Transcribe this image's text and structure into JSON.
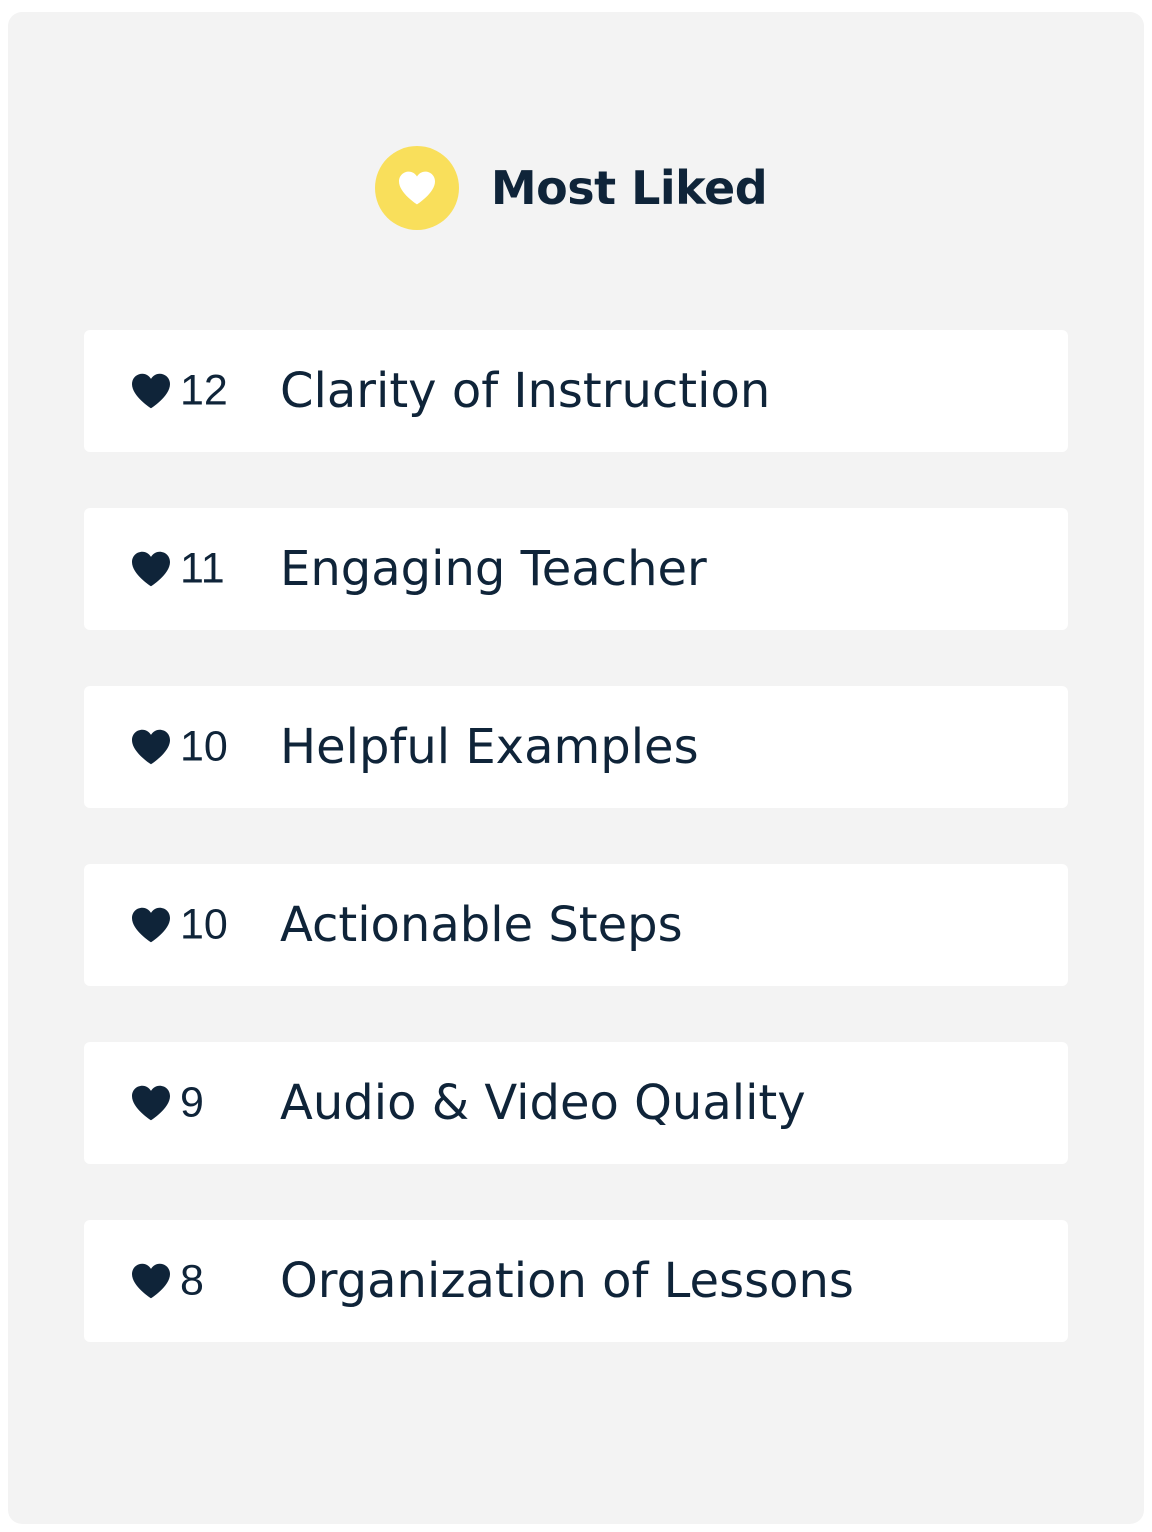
{
  "header": {
    "title": "Most Liked",
    "icon": "heart-icon",
    "badge_color": "#f9df5b"
  },
  "colors": {
    "panel_background": "#f3f3f3",
    "row_background": "#ffffff",
    "text": "#0f2439"
  },
  "items": [
    {
      "count": "12",
      "label": "Clarity of Instruction",
      "icon": "heart-icon"
    },
    {
      "count": "11",
      "label": "Engaging Teacher",
      "icon": "heart-icon"
    },
    {
      "count": "10",
      "label": "Helpful Examples",
      "icon": "heart-icon"
    },
    {
      "count": "10",
      "label": "Actionable Steps",
      "icon": "heart-icon"
    },
    {
      "count": "9",
      "label": "Audio & Video Quality",
      "icon": "heart-icon"
    },
    {
      "count": "8",
      "label": "Organization of Lessons",
      "icon": "heart-icon"
    }
  ]
}
